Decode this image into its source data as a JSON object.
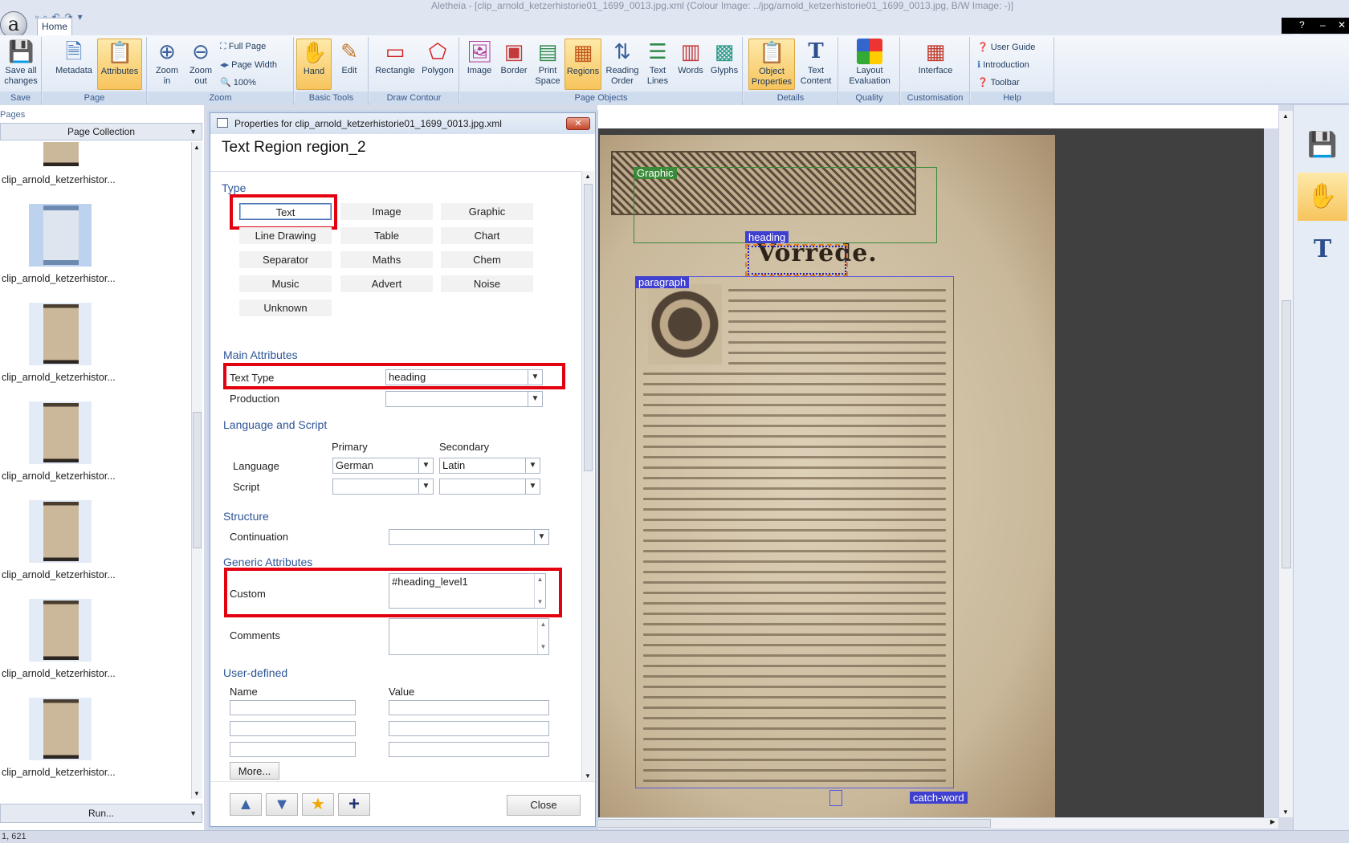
{
  "window": {
    "title": "Aletheia - [clip_arnold_ketzerhistorie01_1699_0013.jpg.xml   (Colour Image: ../jpg/arnold_ketzerhistorie01_1699_0013.jpg,  B/W Image: -)]"
  },
  "ribbon": {
    "tab": "Home",
    "groups": {
      "save": {
        "label": "Save",
        "save_all": "Save all\nchanges"
      },
      "page": {
        "label": "Page",
        "metadata": "Metadata",
        "attributes": "Attributes"
      },
      "zoom": {
        "label": "Zoom",
        "zoom_in": "Zoom\nin",
        "zoom_out": "Zoom\nout",
        "full_page": "Full Page",
        "page_width": "Page Width",
        "percent": "100%"
      },
      "basic_tools": {
        "label": "Basic Tools",
        "hand": "Hand",
        "edit": "Edit"
      },
      "draw_contour": {
        "label": "Draw Contour",
        "rectangle": "Rectangle",
        "polygon": "Polygon"
      },
      "page_objects": {
        "label": "Page Objects",
        "image": "Image",
        "border": "Border",
        "print_space": "Print\nSpace",
        "regions": "Regions",
        "reading_order": "Reading\nOrder",
        "text_lines": "Text\nLines",
        "words": "Words",
        "glyphs": "Glyphs"
      },
      "details": {
        "label": "Details",
        "object_properties": "Object\nProperties",
        "text_content": "Text\nContent"
      },
      "quality": {
        "label": "Quality",
        "layout_evaluation": "Layout\nEvaluation"
      },
      "customisation": {
        "label": "Customisation",
        "interface": "Interface"
      },
      "help": {
        "label": "Help",
        "user_guide": "User Guide",
        "introduction": "Introduction",
        "toolbar": "Toolbar"
      }
    }
  },
  "left_panel": {
    "header": "Pages",
    "collection": "Page Collection",
    "thumbnails": [
      {
        "label": "clip_arnold_ketzerhistor..."
      },
      {
        "label": "clip_arnold_ketzerhistor..."
      },
      {
        "label": "clip_arnold_ketzerhistor..."
      },
      {
        "label": "clip_arnold_ketzerhistor..."
      },
      {
        "label": "clip_arnold_ketzerhistor..."
      },
      {
        "label": "clip_arnold_ketzerhistor..."
      },
      {
        "label": "clip_arnold_ketzerhistor..."
      }
    ],
    "run": "Run..."
  },
  "dialog": {
    "title": "Properties for clip_arnold_ketzerhistorie01_1699_0013.jpg.xml",
    "heading": "Text Region region_2",
    "type_section": "Type",
    "types": [
      "Text",
      "Image",
      "Graphic",
      "Line Drawing",
      "Table",
      "Chart",
      "Separator",
      "Maths",
      "Chem",
      "Music",
      "Advert",
      "Noise",
      "Unknown"
    ],
    "selected_type": "Text",
    "main_attributes": {
      "section": "Main Attributes",
      "text_type_label": "Text Type",
      "text_type_value": "heading",
      "production_label": "Production",
      "production_value": ""
    },
    "language_script": {
      "section": "Language and Script",
      "primary_header": "Primary",
      "secondary_header": "Secondary",
      "language_label": "Language",
      "language_primary": "German",
      "language_secondary": "Latin",
      "script_label": "Script",
      "script_primary": "",
      "script_secondary": ""
    },
    "structure": {
      "section": "Structure",
      "continuation_label": "Continuation",
      "continuation_value": ""
    },
    "generic": {
      "section": "Generic Attributes",
      "custom_label": "Custom",
      "custom_value": "#heading_level1",
      "comments_label": "Comments",
      "comments_value": ""
    },
    "user_defined": {
      "section": "User-defined",
      "name_header": "Name",
      "value_header": "Value",
      "more": "More..."
    },
    "close": "Close"
  },
  "document": {
    "regions": {
      "graphic": "Graphic",
      "heading": "heading",
      "paragraph": "paragraph",
      "catch_word": "catch-word"
    },
    "heading_text": "Vorrede."
  },
  "status": {
    "coords": "1, 621"
  },
  "colors": {
    "highlight_red": "#e3000f",
    "graphic_green": "#3a8a3a",
    "region_blue": "#4040d0",
    "active_orange": "#f7c45d"
  }
}
